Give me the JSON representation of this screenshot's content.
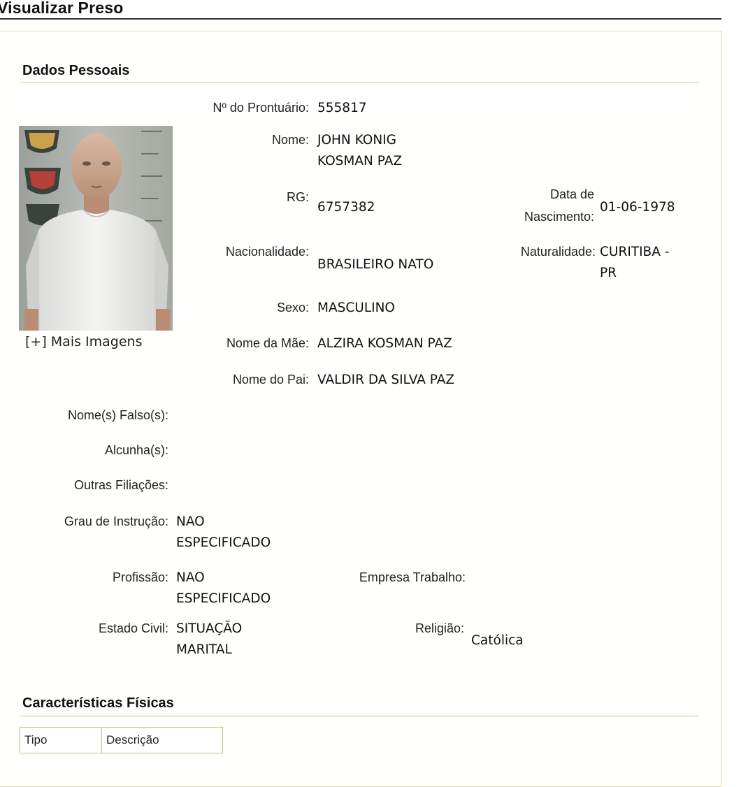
{
  "page": {
    "title": "Visualizar Preso"
  },
  "personal": {
    "heading": "Dados Pessoais",
    "photo_alt": "Foto do preso",
    "more_images": "[+] Mais Imagens",
    "prontuario": {
      "label": "Nº do Prontuário:",
      "value": "555817"
    },
    "nome": {
      "label": "Nome:",
      "value_line1": "JOHN KONIG",
      "value_line2": "KOSMAN PAZ"
    },
    "rg": {
      "label": "RG:",
      "value": "6757382"
    },
    "data_nascimento": {
      "label_line1": "Data de",
      "label_line2": "Nascimento:",
      "value": "01-06-1978"
    },
    "nacionalidade": {
      "label": "Nacionalidade:",
      "value": "BRASILEIRO NATO"
    },
    "naturalidade": {
      "label": "Naturalidade:",
      "value_line1": "CURITIBA -",
      "value_line2": "PR"
    },
    "sexo": {
      "label": "Sexo:",
      "value": "MASCULINO"
    },
    "nome_mae": {
      "label": "Nome da Mãe:",
      "value": "ALZIRA KOSMAN PAZ"
    },
    "nome_pai": {
      "label": "Nome do Pai:",
      "value": "VALDIR DA SILVA PAZ"
    },
    "nomes_falsos": {
      "label": "Nome(s) Falso(s):",
      "value": ""
    },
    "alcunhas": {
      "label": "Alcunha(s):",
      "value": ""
    },
    "outras_filiacoes": {
      "label": "Outras Filiações:",
      "value": ""
    },
    "grau_instrucao": {
      "label": "Grau de Instrução:",
      "value_line1": "NAO",
      "value_line2": "ESPECIFICADO"
    },
    "profissao": {
      "label": "Profissão:",
      "value_line1": "NAO",
      "value_line2": "ESPECIFICADO"
    },
    "empresa_trabalho": {
      "label": "Empresa Trabalho:",
      "value": ""
    },
    "estado_civil": {
      "label": "Estado Civil:",
      "value_line1": "SITUAÇÃO",
      "value_line2": "MARITAL"
    },
    "religiao": {
      "label": "Religião:",
      "value": "Católica"
    }
  },
  "physical": {
    "heading": "Características Físicas",
    "columns": [
      "Tipo",
      "Descrição"
    ]
  }
}
